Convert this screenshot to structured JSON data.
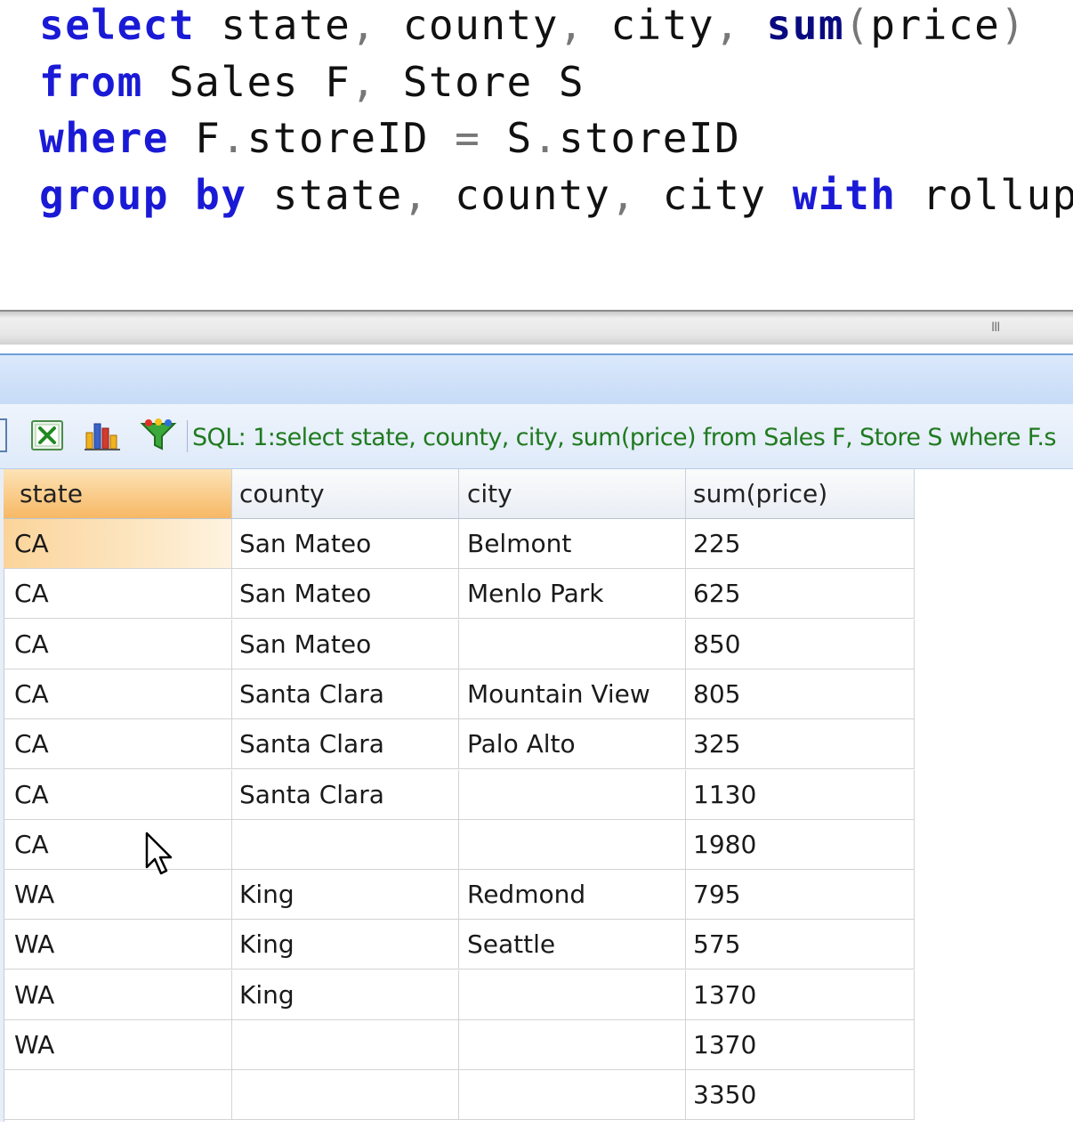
{
  "editor": {
    "lines": [
      [
        "select",
        " state",
        ",",
        " county",
        ",",
        " city",
        ",",
        " sum",
        "(",
        "price",
        ")"
      ],
      [
        "from",
        " Sales F",
        ",",
        " Store S"
      ],
      [
        "where",
        " F",
        ".",
        "storeID ",
        "=",
        " S",
        ".",
        "storeID"
      ],
      [
        "group by",
        " state",
        ",",
        " county",
        ",",
        " city ",
        "with",
        " rollup;"
      ]
    ]
  },
  "toolbar": {
    "icons": [
      "grid-icon",
      "excel-export-icon",
      "chart-icon",
      "filter-icon"
    ],
    "sql_text": "SQL: 1:select state, county, city, sum(price)  from Sales F, Store S  where F.s"
  },
  "results": {
    "columns": [
      "state",
      "county",
      "city",
      "sum(price)"
    ],
    "rows": [
      [
        "CA",
        "San Mateo",
        "Belmont",
        "225"
      ],
      [
        "CA",
        "San Mateo",
        "Menlo Park",
        "625"
      ],
      [
        "CA",
        "San Mateo",
        "",
        "850"
      ],
      [
        "CA",
        "Santa Clara",
        "Mountain View",
        "805"
      ],
      [
        "CA",
        "Santa Clara",
        "Palo Alto",
        "325"
      ],
      [
        "CA",
        "Santa Clara",
        "",
        "1130"
      ],
      [
        "CA",
        "",
        "",
        "1980"
      ],
      [
        "WA",
        "King",
        "Redmond",
        "795"
      ],
      [
        "WA",
        "King",
        "Seattle",
        "575"
      ],
      [
        "WA",
        "King",
        "",
        "1370"
      ],
      [
        "WA",
        "",
        "",
        "1370"
      ],
      [
        "",
        "",
        "",
        "3350"
      ]
    ]
  },
  "scrollbar": {
    "grip": "III"
  },
  "colors": {
    "keyword": "#1a1ad6",
    "sql_label": "#1f7a1f",
    "selected_cell": "#fbd49a"
  }
}
